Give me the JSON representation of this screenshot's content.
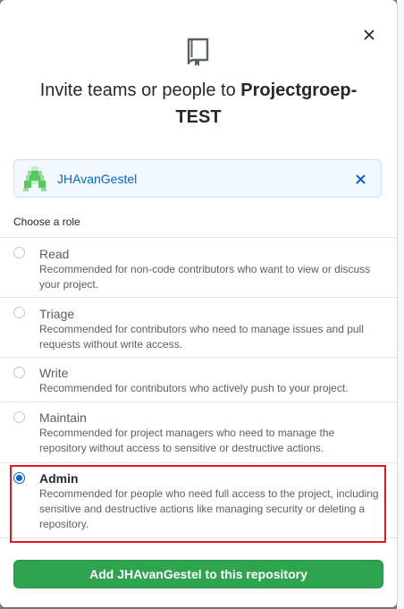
{
  "dialog": {
    "title_prefix": "Invite teams or people to ",
    "title_repo": "Projectgroep-TEST",
    "close_icon": "close-icon",
    "repo_icon": "repo-icon"
  },
  "selected_user": {
    "name": "JHAvanGestel",
    "avatar_color": "#57c75f",
    "remove_icon": "close-icon"
  },
  "roles": {
    "heading": "Choose a role",
    "items": [
      {
        "name": "Read",
        "description": "Recommended for non-code contributors who want to view or discuss your project.",
        "checked": false
      },
      {
        "name": "Triage",
        "description": "Recommended for contributors who need to manage issues and pull requests without write access.",
        "checked": false
      },
      {
        "name": "Write",
        "description": "Recommended for contributors who actively push to your project.",
        "checked": false
      },
      {
        "name": "Maintain",
        "description": "Recommended for project managers who need to manage the repository without access to sensitive or destructive actions.",
        "checked": false
      },
      {
        "name": "Admin",
        "description": "Recommended for people who need full access to the project, including sensitive and destructive actions like managing security or deleting a repository.",
        "checked": true
      }
    ]
  },
  "submit": {
    "label": "Add JHAvanGestel to this repository",
    "color": "#2ea44f"
  },
  "colors": {
    "accent": "#0366d6",
    "highlight": "#e8141e"
  }
}
